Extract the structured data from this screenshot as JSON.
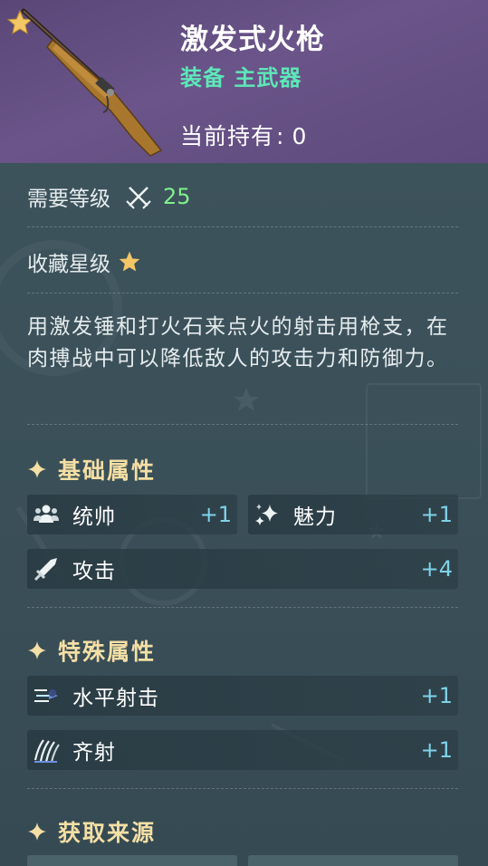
{
  "item": {
    "name": "激发式火枪",
    "type": "装备 主武器",
    "owned_label": "当前持有",
    "owned_sep": ":",
    "owned_count": "0",
    "rarity_stars": 1
  },
  "requirements": {
    "level_label": "需要等级",
    "level_value": "25",
    "collection_label": "收藏星级"
  },
  "description": "用激发锤和打火石来点火的射击用枪支，在肉搏战中可以降低敌人的攻击力和防御力。",
  "sections": {
    "basic": {
      "title": "基础属性",
      "stats": [
        {
          "label": "统帅",
          "value": "+1",
          "icon": "people-icon"
        },
        {
          "label": "魅力",
          "value": "+1",
          "icon": "sparkle-icon"
        },
        {
          "label": "攻击",
          "value": "+4",
          "icon": "sword-icon"
        }
      ]
    },
    "special": {
      "title": "特殊属性",
      "stats": [
        {
          "label": "水平射击",
          "value": "+1",
          "icon": "horizontal-shot-icon"
        },
        {
          "label": "齐射",
          "value": "+1",
          "icon": "volley-icon"
        }
      ]
    },
    "source": {
      "title": "获取来源"
    }
  },
  "colors": {
    "header_bg": "#6a5489",
    "panel_bg": "#3b5059",
    "type_green": "#5ee7b8",
    "level_green": "#7ff08a",
    "section_gold": "#f4dfa4",
    "stat_blue": "#7fd3ea",
    "star_gold": "#f3c765"
  }
}
